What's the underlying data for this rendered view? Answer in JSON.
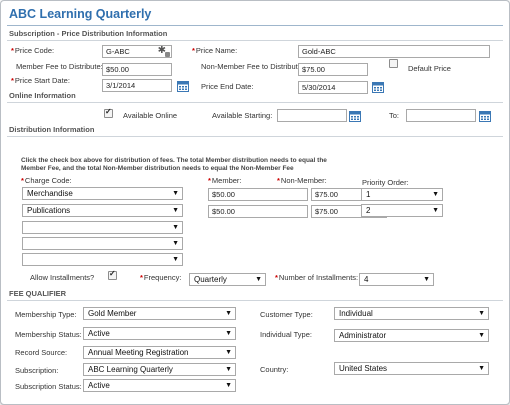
{
  "title": "ABC Learning Quarterly",
  "sections": {
    "subscription": "Subscription - Price Distribution Information",
    "online": "Online Information",
    "distribution": "Distribution Information",
    "fee_qualifier": "FEE QUALIFIER"
  },
  "price": {
    "price_code_label": "Price Code:",
    "price_code_value": "G-ABC",
    "price_name_label": "Price Name:",
    "price_name_value": "Gold-ABC",
    "member_fee_label": "Member Fee to Distribute:",
    "member_fee_value": "$50.00",
    "nonmember_fee_label": "Non-Member Fee to Distribute:",
    "nonmember_fee_value": "$75.00",
    "default_price_label": "Default Price",
    "start_date_label": "Price Start Date:",
    "start_date_value": "3/1/2014",
    "end_date_label": "Price End Date:",
    "end_date_value": "5/30/2014"
  },
  "online": {
    "available_label": "Available Online",
    "available_starting_label": "Available Starting:",
    "available_starting_value": "",
    "to_label": "To:",
    "to_value": ""
  },
  "distribution": {
    "note": "Click the check box above for distribution of fees. The total Member distribution needs to equal the Member Fee, and the total Non-Member distribution needs to equal the Non-Member Fee",
    "charge_code_label": "Charge Code:",
    "member_label": "Member:",
    "nonmember_label": "Non-Member:",
    "priority_label": "Priority Order:",
    "rows": [
      {
        "charge": "Merchandise",
        "member": "$50.00",
        "nonmember": "$75.00",
        "priority": "1"
      },
      {
        "charge": "Publications",
        "member": "$50.00",
        "nonmember": "$75.00",
        "priority": "2"
      },
      {
        "charge": "",
        "member": "",
        "nonmember": "",
        "priority": ""
      },
      {
        "charge": "",
        "member": "",
        "nonmember": "",
        "priority": ""
      },
      {
        "charge": "",
        "member": "",
        "nonmember": "",
        "priority": ""
      }
    ],
    "allow_installments_label": "Allow Installments?",
    "frequency_label": "Frequency:",
    "frequency_value": "Quarterly",
    "num_installments_label": "Number of Installments:",
    "num_installments_value": "4"
  },
  "fee": {
    "membership_type_label": "Membership Type:",
    "membership_type_value": "Gold Member",
    "customer_type_label": "Customer Type:",
    "customer_type_value": "Individual",
    "membership_status_label": "Membership Status:",
    "membership_status_value": "Active",
    "individual_type_label": "Individual Type:",
    "individual_type_value": "Administrator",
    "record_source_label": "Record Source:",
    "record_source_value": "Annual Meeting Registration",
    "subscription_label": "Subscription:",
    "subscription_value": "ABC Learning Quarterly",
    "country_label": "Country:",
    "country_value": "United States",
    "subscription_status_label": "Subscription Status:",
    "subscription_status_value": "Active"
  },
  "colors": {
    "title": "#2f6fae",
    "required": "#cc0000",
    "calendar": "#3b78b5"
  }
}
